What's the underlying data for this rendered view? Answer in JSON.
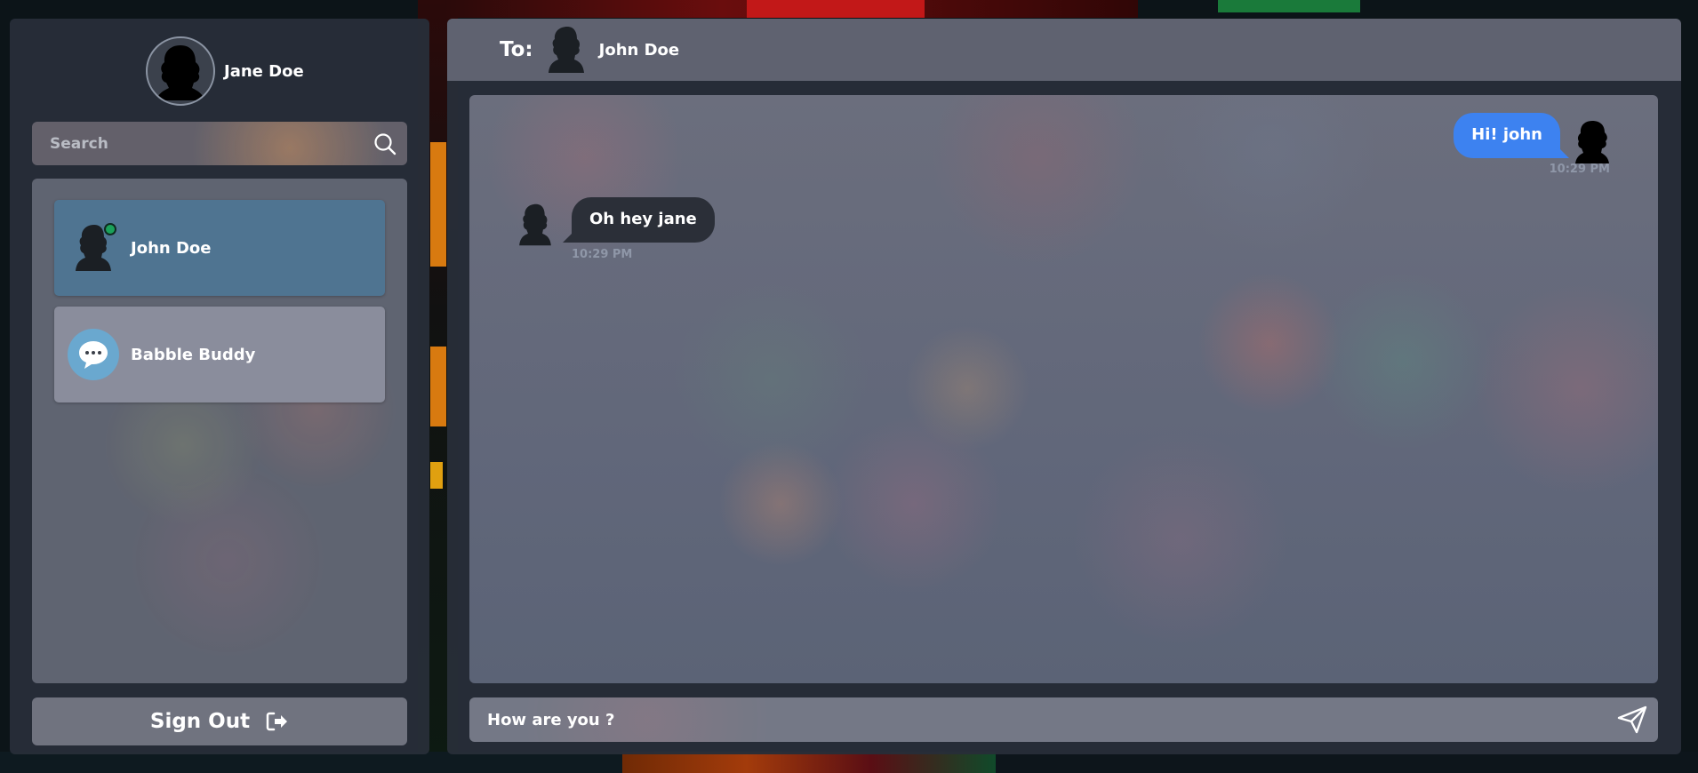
{
  "user": {
    "name": "Jane Doe"
  },
  "search": {
    "placeholder": "Search",
    "value": ""
  },
  "contacts": [
    {
      "name": "John Doe",
      "online": true,
      "selected": true
    },
    {
      "name": "Babble Buddy",
      "online": false,
      "selected": false
    }
  ],
  "signout": {
    "label": "Sign Out"
  },
  "chat": {
    "to_label": "To:",
    "recipient": "John Doe",
    "messages": [
      {
        "direction": "outgoing",
        "text": "Hi! john",
        "time": "10:29 PM"
      },
      {
        "direction": "incoming",
        "text": "Oh hey jane",
        "time": "10:29 PM"
      }
    ],
    "composer": {
      "value": "How are you ?"
    }
  },
  "colors": {
    "outgoing_bubble": "#3d82f0",
    "incoming_bubble": "#2b2f38",
    "selected_contact": "#4f7491",
    "online_indicator": "#1aa15a"
  },
  "icons": {
    "search": "search-icon",
    "signout": "sign-out-icon",
    "send": "send-icon",
    "bot": "chat-bubble-icon"
  }
}
